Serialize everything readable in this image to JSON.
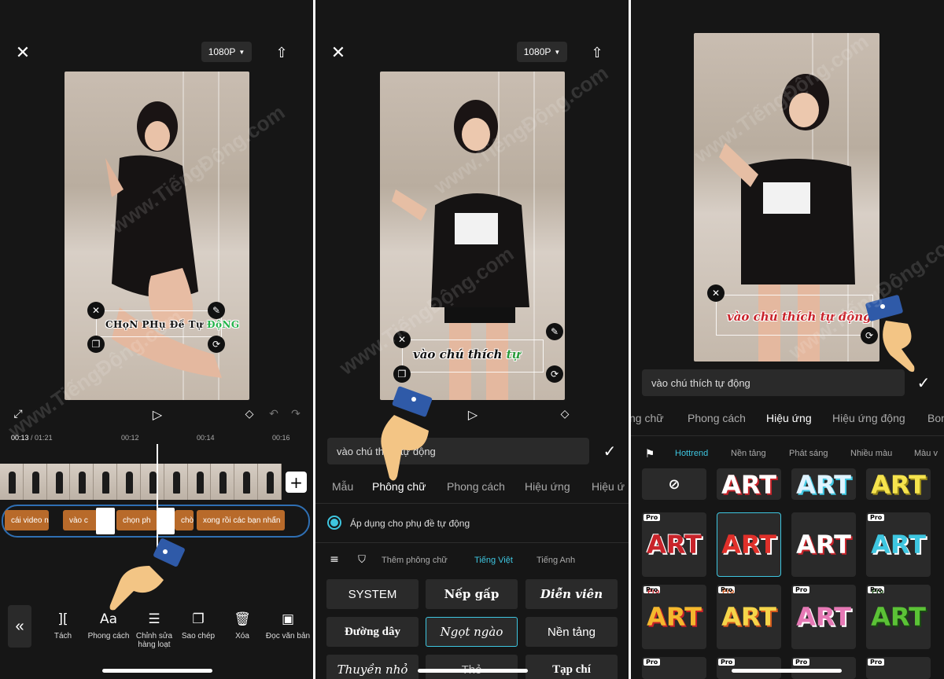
{
  "panel1": {
    "resolution": "1080P",
    "caption_text": "CHọN PHụ Đề Tự",
    "caption_highlight": "ĐộNG",
    "timecode_current": "00:13",
    "timecode_total": "01:21",
    "ruler_marks": [
      "00:12",
      "00:14",
      "00:16"
    ],
    "subtitle_clips": [
      "cái video n",
      "vào c",
      "chọn ph",
      "chờ",
      "xong rồi các bạn nhấn"
    ],
    "toolbar": [
      {
        "label": "Tách",
        "icon": "split-icon"
      },
      {
        "label": "Phong cách",
        "icon": "text-style-icon"
      },
      {
        "label": "Chỉnh sửa hàng loạt",
        "icon": "batch-edit-icon"
      },
      {
        "label": "Sao chép",
        "icon": "copy-icon"
      },
      {
        "label": "Xóa",
        "icon": "trash-icon"
      },
      {
        "label": "Đọc văn bản",
        "icon": "read-text-icon"
      }
    ]
  },
  "panel2": {
    "resolution": "1080P",
    "caption_text": "vào chú thích",
    "caption_highlight": "tự",
    "input_value": "vào chú thích tự động",
    "tabs": [
      "Mẫu",
      "Phông chữ",
      "Phong cách",
      "Hiệu ứng",
      "Hiệu ứ"
    ],
    "active_tab": "Phông chữ",
    "apply_auto_caption": "Áp dụng cho phụ đề tự động",
    "font_sub_tabs": [
      "Thêm phông chữ",
      "Tiếng Việt",
      "Tiếng Anh"
    ],
    "active_sub_tab": "Tiếng Việt",
    "fonts": [
      "SYSTEM",
      "Nếp gấp",
      "Diễn viên",
      "Đường dây",
      "Ngọt ngào",
      "Nền tảng",
      "Thuyền nhỏ",
      "Thỏ",
      "Tạp chí"
    ],
    "selected_font": "Ngọt ngào"
  },
  "panel3": {
    "caption_text": "vào chú thích tự",
    "caption_highlight": "động",
    "input_value": "vào chú thích tự động",
    "tabs": [
      "ng chữ",
      "Phong cách",
      "Hiệu ứng",
      "Hiệu ứng động",
      "Bon"
    ],
    "active_tab": "Hiệu ứng",
    "effect_sub_tabs": [
      "Hottrend",
      "Nền tảng",
      "Phát sáng",
      "Nhiều màu",
      "Màu v"
    ],
    "active_sub_tab": "Hottrend",
    "art_label": "ART",
    "pro_label": "Pro"
  },
  "watermark_text": "www.TiếngĐộng.com",
  "colors": {
    "accent_cyan": "#3ec6e0",
    "clip_orange": "#b86a2a",
    "timeline_blue": "#2f6fb3",
    "hand_skin": "#f3c585",
    "cuff_blue": "#2f5aa8"
  }
}
